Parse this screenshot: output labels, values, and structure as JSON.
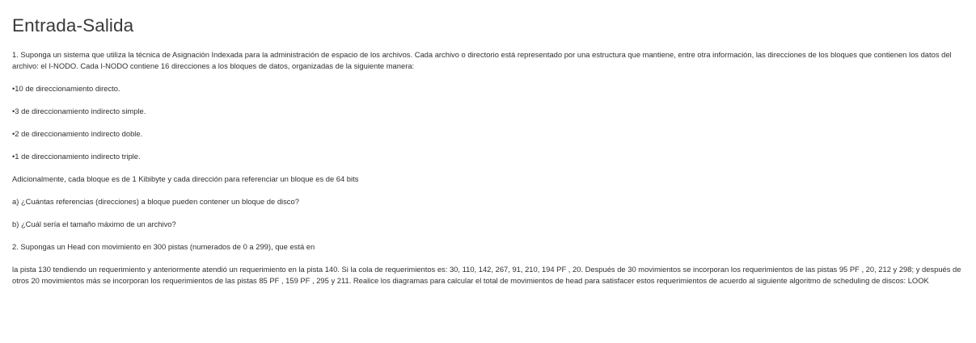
{
  "document": {
    "title": "Entrada-Salida",
    "paragraphs": [
      "1. Suponga un sistema que utiliza la técnica de Asignación Indexada para la administración de espacio de los archivos. Cada archivo o directorio está representado por una estructura que mantiene, entre otra información, las direcciones de los bloques que contienen los datos del archivo: el I-NODO. Cada I-NODO contiene 16 direcciones a los bloques de datos, organizadas de la siguiente manera:",
      "•10 de direccionamiento directo.",
      "•3 de direccionamiento indirecto simple.",
      "•2 de direccionamiento indirecto doble.",
      "•1 de direccionamiento indirecto triple.",
      "Adicionalmente, cada bloque es de 1 Kibibyte y cada dirección para referenciar un bloque es de 64 bits",
      "a) ¿Cuántas referencias (direcciones) a bloque pueden contener un bloque de disco?",
      "b) ¿Cuál sería el tamaño máximo de un archivo?",
      "2. Supongas un Head con movimiento en 300 pistas (numerados de 0 a 299), que está en",
      "la pista 130 tendiendo un requerimiento y anteriormente atendió un requerimiento en la pista 140. Si la cola de requerimientos es: 30, 110, 142, 267, 91, 210, 194 PF , 20. Después de 30 movimientos se incorporan los requerimientos de las pistas 95 PF , 20, 212 y 298; y después de otros 20 movimientos más se incorporan los requerimientos de las pistas 85 PF , 159 PF , 295 y 211. Realice los diagramas para calcular el total de movimientos de head para satisfacer estos requerimientos de acuerdo al siguiente algoritmo de scheduling de discos: LOOK"
    ]
  }
}
